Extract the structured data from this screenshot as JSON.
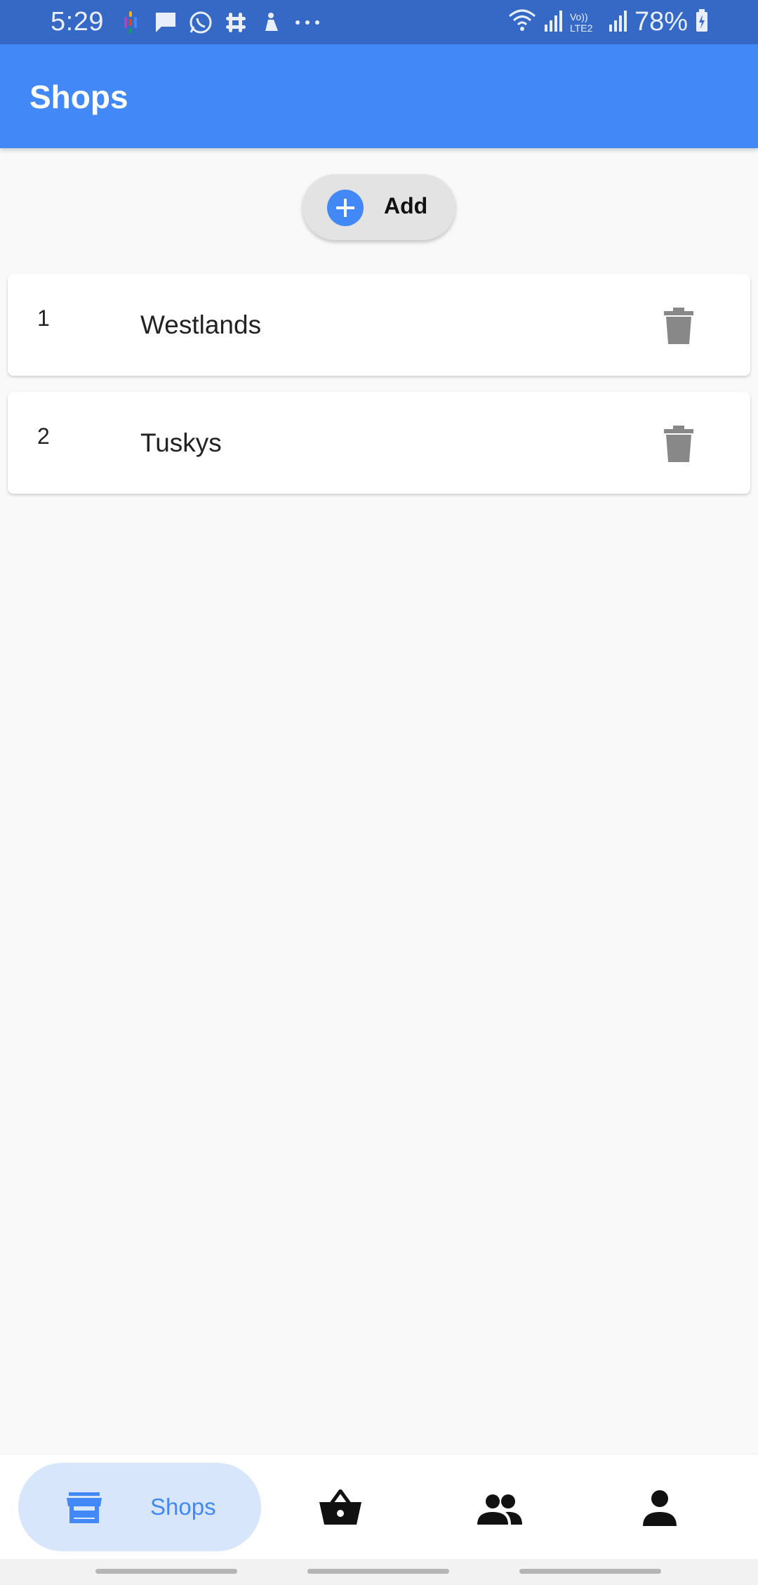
{
  "status_bar": {
    "time": "5:29",
    "battery": "78%",
    "network_label": "Vo)) LTE2"
  },
  "app_bar": {
    "title": "Shops"
  },
  "add_button": {
    "label": "Add",
    "icon": "add-circle-icon"
  },
  "shops": [
    {
      "number": "1",
      "name": "Westlands"
    },
    {
      "number": "2",
      "name": "Tuskys"
    }
  ],
  "bottom_nav": {
    "active_label": "Shops",
    "items": [
      {
        "icon": "store-icon",
        "label": "Shops",
        "active": true
      },
      {
        "icon": "basket-icon"
      },
      {
        "icon": "people-icon"
      },
      {
        "icon": "person-icon"
      }
    ]
  },
  "colors": {
    "status_bar": "#3669c6",
    "app_bar": "#4289f7",
    "accent": "#4289f7",
    "active_nav_bg": "#d8e6fb",
    "trash_icon": "#888888"
  }
}
